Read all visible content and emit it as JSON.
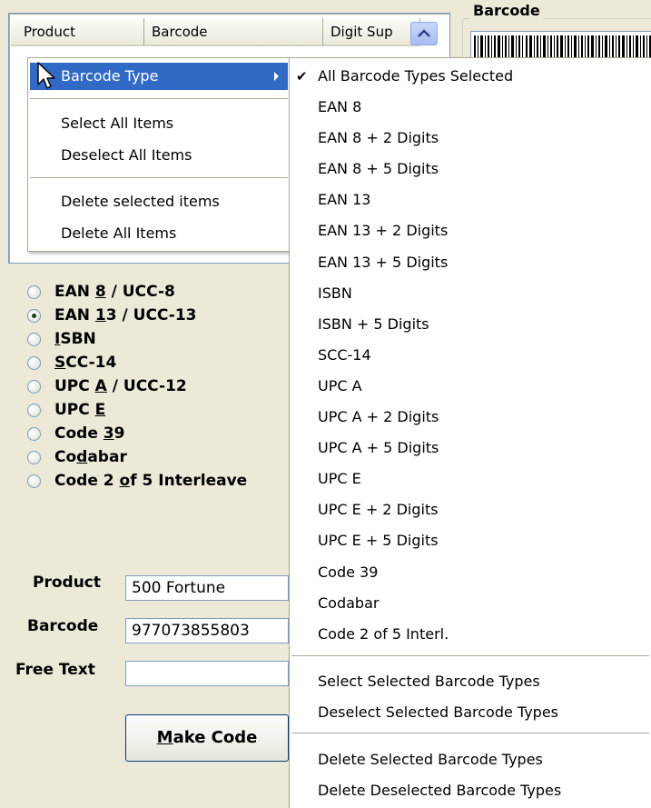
{
  "listview": {
    "columns": [
      "Product",
      "Barcode",
      "Digit Sup"
    ]
  },
  "barcode_group": {
    "label": "Barcode"
  },
  "radios": [
    {
      "pre": "EAN ",
      "u": "8",
      "post": " / UCC-8",
      "checked": false
    },
    {
      "pre": "EAN ",
      "u": "1",
      "post": "3 / UCC-13",
      "checked": true
    },
    {
      "pre": "",
      "u": "I",
      "post": "SBN",
      "checked": false
    },
    {
      "pre": "",
      "u": "S",
      "post": "CC-14",
      "checked": false
    },
    {
      "pre": "UPC ",
      "u": "A",
      "post": " / UCC-12",
      "checked": false
    },
    {
      "pre": "UPC ",
      "u": "E",
      "post": "",
      "checked": false
    },
    {
      "pre": "Code ",
      "u": "3",
      "post": "9",
      "checked": false
    },
    {
      "pre": "Co",
      "u": "d",
      "post": "abar",
      "checked": false
    },
    {
      "pre": "Code 2 ",
      "u": "o",
      "post": "f 5 Interleave",
      "checked": false
    }
  ],
  "form": {
    "product_label": "Product",
    "product_value": "500 Fortune",
    "barcode_label": "Barcode",
    "barcode_value": "977073855803",
    "freetext_label": "Free Text",
    "freetext_value": ""
  },
  "make_button": {
    "u": "M",
    "rest": "ake Code"
  },
  "context_menu": {
    "barcode_type": "Barcode Type",
    "select_all": "Select All Items",
    "deselect_all": "Deselect All Items",
    "delete_selected": "Delete selected items",
    "delete_all": "Delete All Items"
  },
  "submenu": {
    "all_selected": "All Barcode Types Selected",
    "types": [
      "EAN 8",
      "EAN 8 + 2 Digits",
      "EAN 8 + 5 Digits",
      "EAN 13",
      "EAN 13 + 2 Digits",
      "EAN 13 + 5 Digits",
      "ISBN",
      "ISBN + 5 Digits",
      "SCC-14",
      "UPC A",
      "UPC A + 2 Digits",
      "UPC A + 5 Digits",
      "UPC E",
      "UPC E + 2 Digits",
      "UPC E + 5 Digits",
      "Code 39",
      "Codabar",
      "Code 2 of 5 Interl."
    ],
    "select_selected": "Select Selected Barcode Types",
    "deselect_selected": "Deselect Selected Barcode Types",
    "delete_selected": "Delete Selected Barcode Types",
    "delete_deselected": "Delete Deselected Barcode Types"
  },
  "colors": {
    "menu_highlight": "#316ac5",
    "window_bg": "#ece9d8"
  }
}
